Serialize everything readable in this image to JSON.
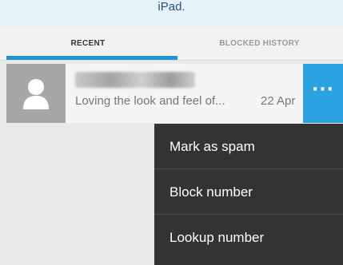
{
  "banner": {
    "text": "iPad."
  },
  "tabs": [
    {
      "label": "RECENT",
      "selected": true
    },
    {
      "label": "BLOCKED HISTORY",
      "selected": false
    }
  ],
  "colors": {
    "accent": "#1f96d3",
    "menu_background": "#333333",
    "avatar_background": "#a7a7a7"
  },
  "row": {
    "avatar_icon": "person-icon",
    "name_obscured": true,
    "snippet": "Loving the look and feel of...",
    "date": "22 Apr",
    "more_icon": "···"
  },
  "menu": {
    "items": [
      {
        "label": "Mark as spam"
      },
      {
        "label": "Block number"
      },
      {
        "label": "Lookup number"
      }
    ]
  }
}
